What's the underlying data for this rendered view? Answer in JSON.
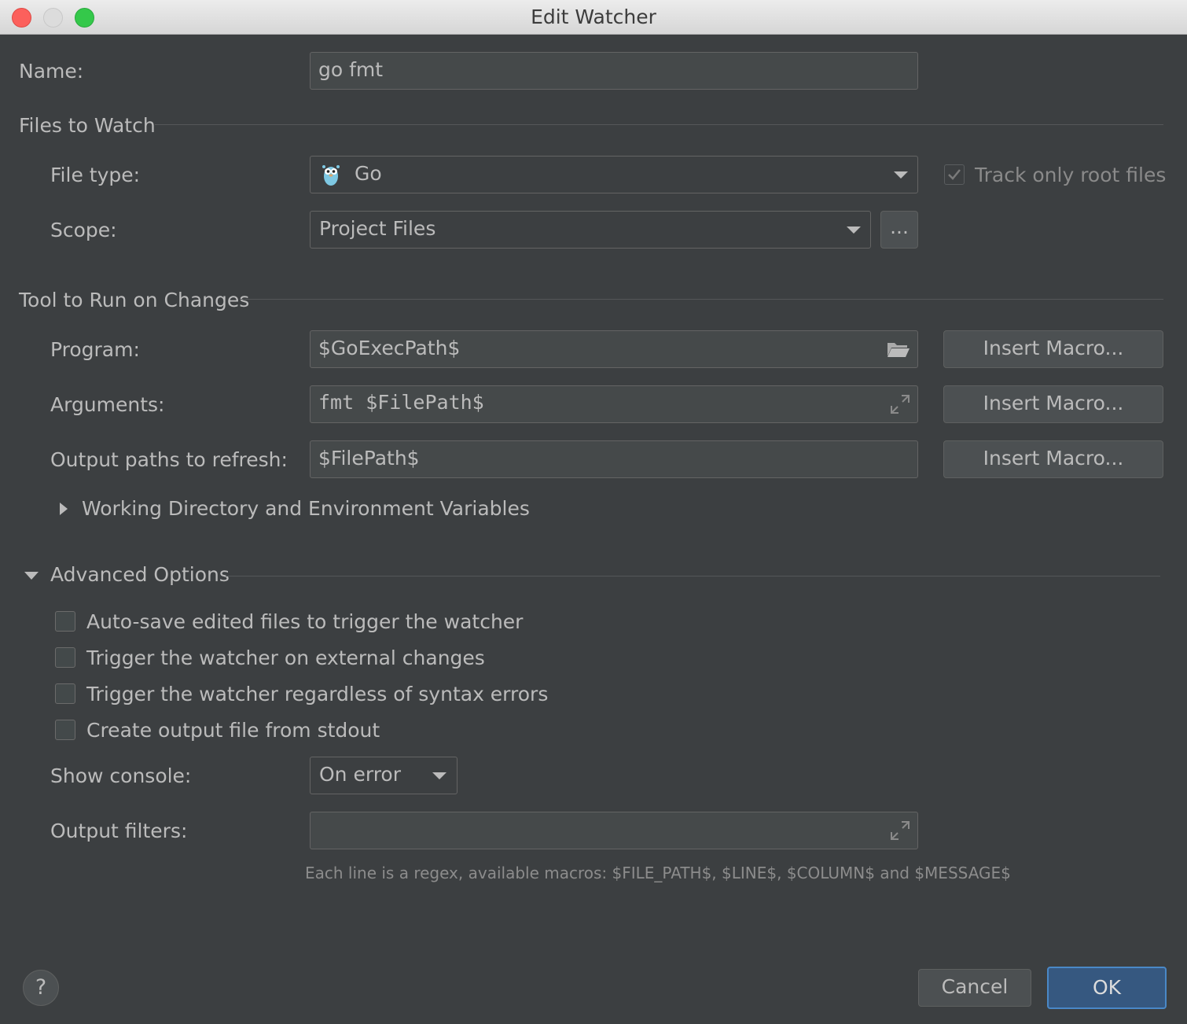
{
  "window": {
    "title": "Edit Watcher"
  },
  "name": {
    "label": "Name:",
    "value": "go fmt"
  },
  "files_to_watch": {
    "section_title": "Files to Watch",
    "file_type": {
      "label": "File type:",
      "value": "Go"
    },
    "track_only_root": {
      "label": "Track only root files",
      "checked": true,
      "enabled": false
    },
    "scope": {
      "label": "Scope:",
      "value": "Project Files",
      "browse_label": "..."
    }
  },
  "tool": {
    "section_title": "Tool to Run on Changes",
    "program": {
      "label": "Program:",
      "value": "$GoExecPath$"
    },
    "arguments": {
      "label": "Arguments:",
      "value": "fmt $FilePath$"
    },
    "output_paths": {
      "label": "Output paths to refresh:",
      "value": "$FilePath$"
    },
    "insert_macro_label": "Insert Macro...",
    "working_dir": {
      "label": "Working Directory and Environment Variables",
      "expanded": false
    }
  },
  "advanced": {
    "section_title": "Advanced Options",
    "expanded": true,
    "options": [
      {
        "label": "Auto-save edited files to trigger the watcher",
        "checked": false
      },
      {
        "label": "Trigger the watcher on external changes",
        "checked": false
      },
      {
        "label": "Trigger the watcher regardless of syntax errors",
        "checked": false
      },
      {
        "label": "Create output file from stdout",
        "checked": false
      }
    ],
    "show_console": {
      "label": "Show console:",
      "value": "On error"
    },
    "output_filters": {
      "label": "Output filters:",
      "value": "",
      "hint": "Each line is a regex, available macros: $FILE_PATH$, $LINE$, $COLUMN$ and $MESSAGE$"
    }
  },
  "footer": {
    "help_label": "?",
    "cancel_label": "Cancel",
    "ok_label": "OK"
  },
  "colors": {
    "background": "#3c3f41",
    "field": "#45494a",
    "ok_accent": "#365880",
    "text": "#bbbbbb"
  },
  "icons": {
    "file_type": "gopher-icon",
    "program_browse": "folder-icon",
    "expand": "expand-icon"
  }
}
